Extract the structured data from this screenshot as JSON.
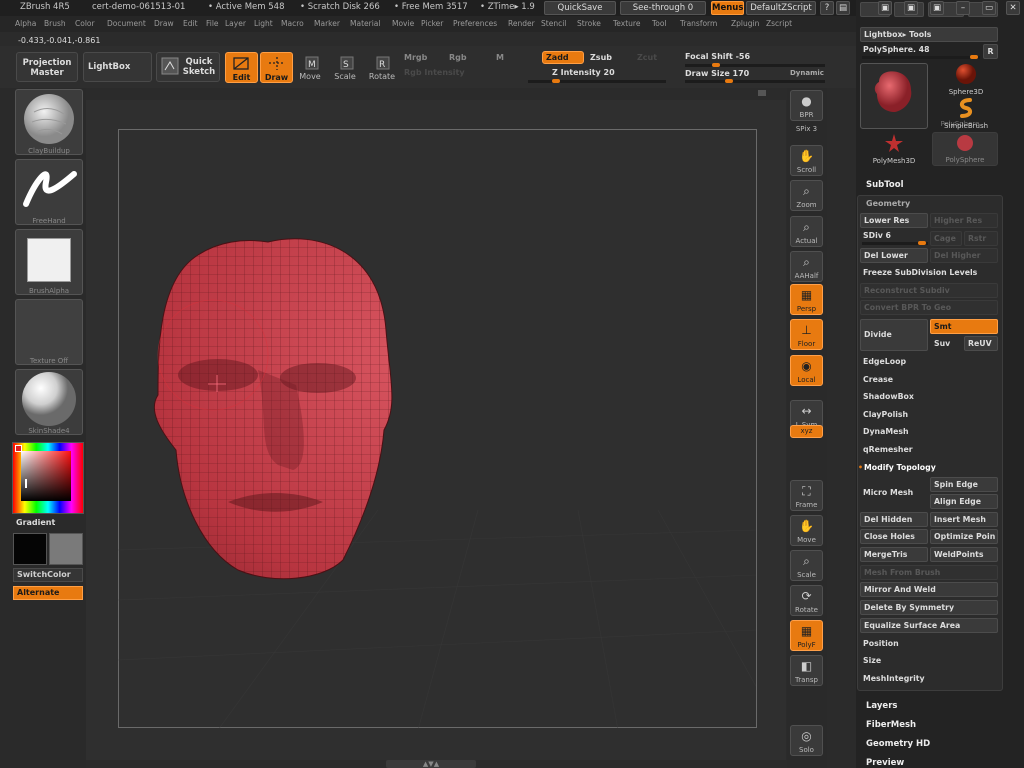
{
  "titlebar": {
    "app": "ZBrush 4R5",
    "doc": "cert-demo-061513-01",
    "active_mem": "• Active Mem 548",
    "scratch": "• Scratch Disk 266",
    "free_mem": "• Free Mem 3517",
    "ztime": "• ZTime▸ 1.9",
    "quicksave": "QuickSave",
    "see_through": "See-through  0",
    "menus": "Menus",
    "script": "DefaultZScript"
  },
  "menubar": [
    "Alpha",
    "Brush",
    "Color",
    "Document",
    "Draw",
    "Edit",
    "File",
    "Layer",
    "Light",
    "Macro",
    "Marker",
    "Material",
    "Movie",
    "Picker",
    "Preferences",
    "Render",
    "Stencil",
    "Stroke",
    "Texture",
    "Tool",
    "Transform",
    "Zplugin",
    "Zscript"
  ],
  "coords": "-0.433,-0.041,-0.861",
  "toolbar": {
    "projection_master": "Projection Master",
    "lightbox": "LightBox",
    "quick_sketch": "Quick Sketch",
    "edit": "Edit",
    "draw": "Draw",
    "move": "Move",
    "scale": "Scale",
    "rotate": "Rotate",
    "mrgb": "Mrgb",
    "rgb": "Rgb",
    "m": "M",
    "rgb_intensity": "Rgb Intensity",
    "zadd": "Zadd",
    "zsub": "Zsub",
    "zcut": "Zcut",
    "z_intensity": "Z Intensity 20",
    "focal_shift": "Focal Shift -56",
    "draw_size": "Draw Size 170",
    "dynamic": "Dynamic",
    "z_intensity_value": 20,
    "focal_shift_value": -56,
    "draw_size_value": 170
  },
  "leftpanel": {
    "brush": "ClayBuildup",
    "stroke": "FreeHand",
    "alpha": "BrushAlpha",
    "texture": "Texture Off",
    "material": "SkinShade4",
    "gradient": "Gradient",
    "switchcolor": "SwitchColor",
    "alternate": "Alternate"
  },
  "rightshelf": [
    {
      "key": "bpr",
      "label": "BPR",
      "icon": "sphere-icon",
      "orange": false
    },
    {
      "key": "spix",
      "label": "SPix 3",
      "icon": "",
      "orange": false
    },
    {
      "key": "scroll",
      "label": "Scroll",
      "icon": "hand-icon",
      "orange": false
    },
    {
      "key": "zoom",
      "label": "Zoom",
      "icon": "magnifier-icon",
      "orange": false
    },
    {
      "key": "actual",
      "label": "Actual",
      "icon": "magnifier-icon",
      "orange": false
    },
    {
      "key": "aahalf",
      "label": "AAHalf",
      "icon": "magnifier-icon",
      "orange": false
    },
    {
      "key": "persp",
      "label": "Persp",
      "icon": "grid-icon",
      "orange": true
    },
    {
      "key": "floor",
      "label": "Floor",
      "icon": "floor-icon",
      "orange": true
    },
    {
      "key": "local",
      "label": "Local",
      "icon": "local-icon",
      "orange": true
    },
    {
      "key": "lsym",
      "label": "L.Sym",
      "icon": "symmetry-icon",
      "orange": false
    },
    {
      "key": "xyz",
      "label": "xyz",
      "icon": "",
      "orange": true
    },
    {
      "key": "frame",
      "label": "Frame",
      "icon": "frame-icon",
      "orange": false
    },
    {
      "key": "move",
      "label": "Move",
      "icon": "hand-icon",
      "orange": false
    },
    {
      "key": "scale",
      "label": "Scale",
      "icon": "magnifier-icon",
      "orange": false
    },
    {
      "key": "rotate",
      "label": "Rotate",
      "icon": "rotate-icon",
      "orange": false
    },
    {
      "key": "polyf",
      "label": "PolyF",
      "icon": "grid-icon",
      "orange": true
    },
    {
      "key": "transp",
      "label": "Transp",
      "icon": "transp-icon",
      "orange": false
    },
    {
      "key": "solo",
      "label": "Solo",
      "icon": "solo-icon",
      "orange": false
    }
  ],
  "toolpanel": {
    "lightbox_tools": "Lightbox▸ Tools",
    "polysphere_name": "PolySphere. 48",
    "r_button": "R",
    "thumbs": [
      "PolySphere",
      "Sphere3D",
      "SimpleBrush",
      "PolyMesh3D",
      "PolySphere"
    ],
    "subtool": "SubTool",
    "geometry": "Geometry",
    "lower_res": "Lower Res",
    "higher_res": "Higher Res",
    "sdiv": "SDiv 6",
    "cage": "Cage",
    "rstr": "Rstr",
    "del_lower": "Del Lower",
    "del_higher": "Del Higher",
    "freeze": "Freeze SubDivision Levels",
    "reconstruct": "Reconstruct Subdiv",
    "convert": "Convert BPR To Geo",
    "divide": "Divide",
    "smt": "Smt",
    "suv": "Suv",
    "reuv": "ReUV",
    "edgeloop": "EdgeLoop",
    "crease": "Crease",
    "shadowbox": "ShadowBox",
    "claypolish": "ClayPolish",
    "dynamesh": "DynaMesh",
    "qremesher": "qRemesher",
    "modify_topology": "Modify Topology",
    "micro_mesh": "Micro Mesh",
    "spin_edge": "Spin Edge",
    "align_edge": "Align Edge",
    "del_hidden": "Del Hidden",
    "insert_mesh": "Insert Mesh",
    "close_holes": "Close Holes",
    "optimize_point": "Optimize Poin",
    "mergetris": "MergeTris",
    "weldpoints": "WeldPoints",
    "mesh_from_brush": "Mesh From Brush",
    "mirror_and_weld": "Mirror And Weld",
    "delete_by_symmetry": "Delete By Symmetry",
    "equalize": "Equalize Surface Area",
    "position": "Position",
    "size": "Size",
    "meshintegrity": "MeshIntegrity",
    "layers": "Layers",
    "fibermesh": "FiberMesh",
    "geometry_hd": "Geometry HD",
    "preview": "Preview"
  },
  "colors": {
    "accent": "#e87a10",
    "mesh": "#c43c46",
    "background": "#2f2f2f"
  }
}
